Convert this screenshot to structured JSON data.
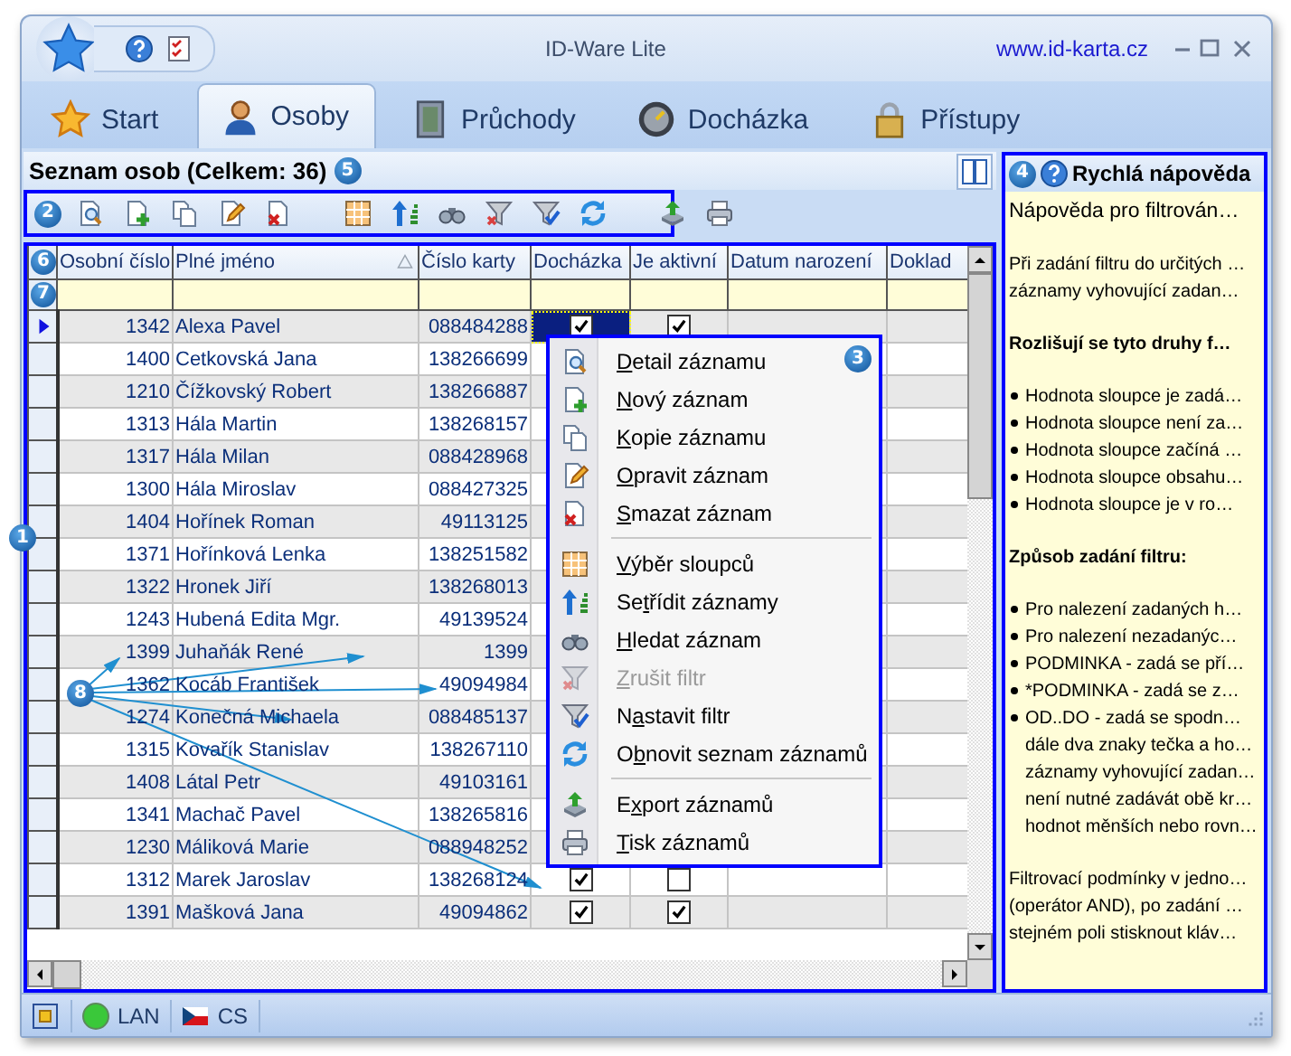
{
  "window": {
    "title": "ID-Ware Lite",
    "link": "www.id-karta.cz"
  },
  "tabs": [
    {
      "label": "Start",
      "selected": false
    },
    {
      "label": "Osoby",
      "selected": true
    },
    {
      "label": "Průchody",
      "selected": false
    },
    {
      "label": "Docházka",
      "selected": false
    },
    {
      "label": "Přístupy",
      "selected": false
    }
  ],
  "list_header": {
    "title": "Seznam osob (Celkem: 36)",
    "callout": "5"
  },
  "toolbar": {
    "callout": "2"
  },
  "grid": {
    "callout": "1",
    "header_callout": "6",
    "filter_callout": "7",
    "columns": [
      "Osobní číslo",
      "Plné jméno",
      "Číslo karty",
      "Docházka",
      "Je aktivní",
      "Datum narození",
      "Doklad"
    ],
    "rows": [
      {
        "id": "1342",
        "name": "Alexa Pavel",
        "card": "088484288",
        "current": true,
        "attendance": true,
        "active": true
      },
      {
        "id": "1400",
        "name": "Cetkovská Jana",
        "card": "138266699",
        "current": false
      },
      {
        "id": "1210",
        "name": "Čížkovský Robert",
        "card": "138266887",
        "current": false
      },
      {
        "id": "1313",
        "name": "Hála Martin",
        "card": "138268157",
        "current": false
      },
      {
        "id": "1317",
        "name": "Hála Milan",
        "card": "088428968",
        "current": false
      },
      {
        "id": "1300",
        "name": "Hála Miroslav",
        "card": "088427325",
        "current": false
      },
      {
        "id": "1404",
        "name": "Hořínek Roman",
        "card": "49113125",
        "current": false
      },
      {
        "id": "1371",
        "name": "Hořínková Lenka",
        "card": "138251582",
        "current": false
      },
      {
        "id": "1322",
        "name": "Hronek Jiří",
        "card": "138268013",
        "current": false
      },
      {
        "id": "1243",
        "name": "Hubená Edita Mgr.",
        "card": "49139524",
        "current": false
      },
      {
        "id": "1399",
        "name": "Juhaňák René",
        "card": "1399",
        "current": false
      },
      {
        "id": "1362",
        "name": "Kocáb František",
        "card": "49094984",
        "current": false
      },
      {
        "id": "1274",
        "name": "Konečná Michaela",
        "card": "088485137",
        "current": false
      },
      {
        "id": "1315",
        "name": "Kovařík Stanislav",
        "card": "138267110",
        "current": false
      },
      {
        "id": "1408",
        "name": "Látal Petr",
        "card": "49103161",
        "current": false
      },
      {
        "id": "1341",
        "name": "Machač Pavel",
        "card": "138265816",
        "current": false
      },
      {
        "id": "1230",
        "name": "Máliková Marie",
        "card": "088948252",
        "current": false
      },
      {
        "id": "1312",
        "name": "Marek Jaroslav",
        "card": "138268124",
        "current": false,
        "attendance": true,
        "active": false
      },
      {
        "id": "1391",
        "name": "Mašková Jana",
        "card": "49094862",
        "current": false,
        "attendance": true,
        "active": true
      }
    ]
  },
  "context_menu": {
    "callout": "3",
    "items": [
      {
        "kind": "item",
        "key": "D",
        "post": "etail záznamu",
        "disabled": false
      },
      {
        "kind": "item",
        "key": "N",
        "post": "ový záznam",
        "disabled": false
      },
      {
        "kind": "item",
        "key": "K",
        "post": "opie záznamu",
        "disabled": false
      },
      {
        "kind": "item",
        "key": "O",
        "post": "pravit záznam",
        "disabled": false
      },
      {
        "kind": "item",
        "key": "S",
        "post": "mazat záznam",
        "disabled": false
      },
      {
        "kind": "separator"
      },
      {
        "kind": "item",
        "key": "V",
        "post": "ýběr sloupců",
        "disabled": false
      },
      {
        "kind": "item",
        "pre": "Se",
        "key": "t",
        "post": "řídit záznamy",
        "disabled": false
      },
      {
        "kind": "item",
        "key": "H",
        "post": "ledat záznam",
        "disabled": false
      },
      {
        "kind": "item",
        "key": "Z",
        "post": "rušit filtr",
        "disabled": true
      },
      {
        "kind": "item",
        "pre": "N",
        "key": "a",
        "post": "stavit filtr",
        "disabled": false
      },
      {
        "kind": "item",
        "pre": "O",
        "key": "b",
        "post": "novit seznam záznamů",
        "disabled": false
      },
      {
        "kind": "separator"
      },
      {
        "kind": "item",
        "pre": "E",
        "key": "x",
        "post": "port záznamů",
        "disabled": false
      },
      {
        "kind": "item",
        "key": "T",
        "post": "isk záznamů",
        "disabled": false
      }
    ]
  },
  "help": {
    "callout": "4",
    "title": "Rychlá nápověda",
    "blocks": [
      {
        "kind": "title",
        "lines": [
          "Nápověda pro filtrován…"
        ]
      },
      {
        "kind": "para",
        "lines": [
          "Při zadání filtru do určitých …",
          "záznamy vyhovující zadan…"
        ]
      },
      {
        "kind": "heading",
        "lines": [
          "Rozlišují se tyto druhy f…"
        ]
      },
      {
        "kind": "bullets",
        "items": [
          {
            "lines": [
              "Hodnota sloupce je zadá…"
            ]
          },
          {
            "lines": [
              "Hodnota sloupce není za…"
            ]
          },
          {
            "lines": [
              "Hodnota sloupce začíná …"
            ]
          },
          {
            "lines": [
              "Hodnota sloupce obsahu…"
            ]
          },
          {
            "lines": [
              "Hodnota sloupce je v ro…"
            ]
          }
        ]
      },
      {
        "kind": "heading",
        "lines": [
          "Způsob zadání filtru:"
        ]
      },
      {
        "kind": "bullets",
        "items": [
          {
            "lines": [
              "Pro nalezení zadaných h…"
            ]
          },
          {
            "lines": [
              "Pro nalezení nezadanýc…"
            ]
          },
          {
            "lines": [
              "PODMINKA - zadá se pří…"
            ]
          },
          {
            "lines": [
              "*PODMINKA - zadá se z…"
            ]
          },
          {
            "lines": [
              "OD..DO - zadá se spodn…",
              "dále dva znaky tečka a ho…",
              "záznamy vyhovující zadan…",
              "není nutné zadávát obě kr…",
              "hodnot měnších nebo rovn…"
            ]
          }
        ]
      },
      {
        "kind": "para",
        "lines": [
          "Filtrovací podmínky v jedno…",
          "(operátor AND), po zadání …",
          "stejném poli stisknout kláv…"
        ]
      }
    ]
  },
  "annotation": {
    "callout": "8"
  },
  "status_bar": {
    "network": "LAN",
    "language": "CS"
  }
}
